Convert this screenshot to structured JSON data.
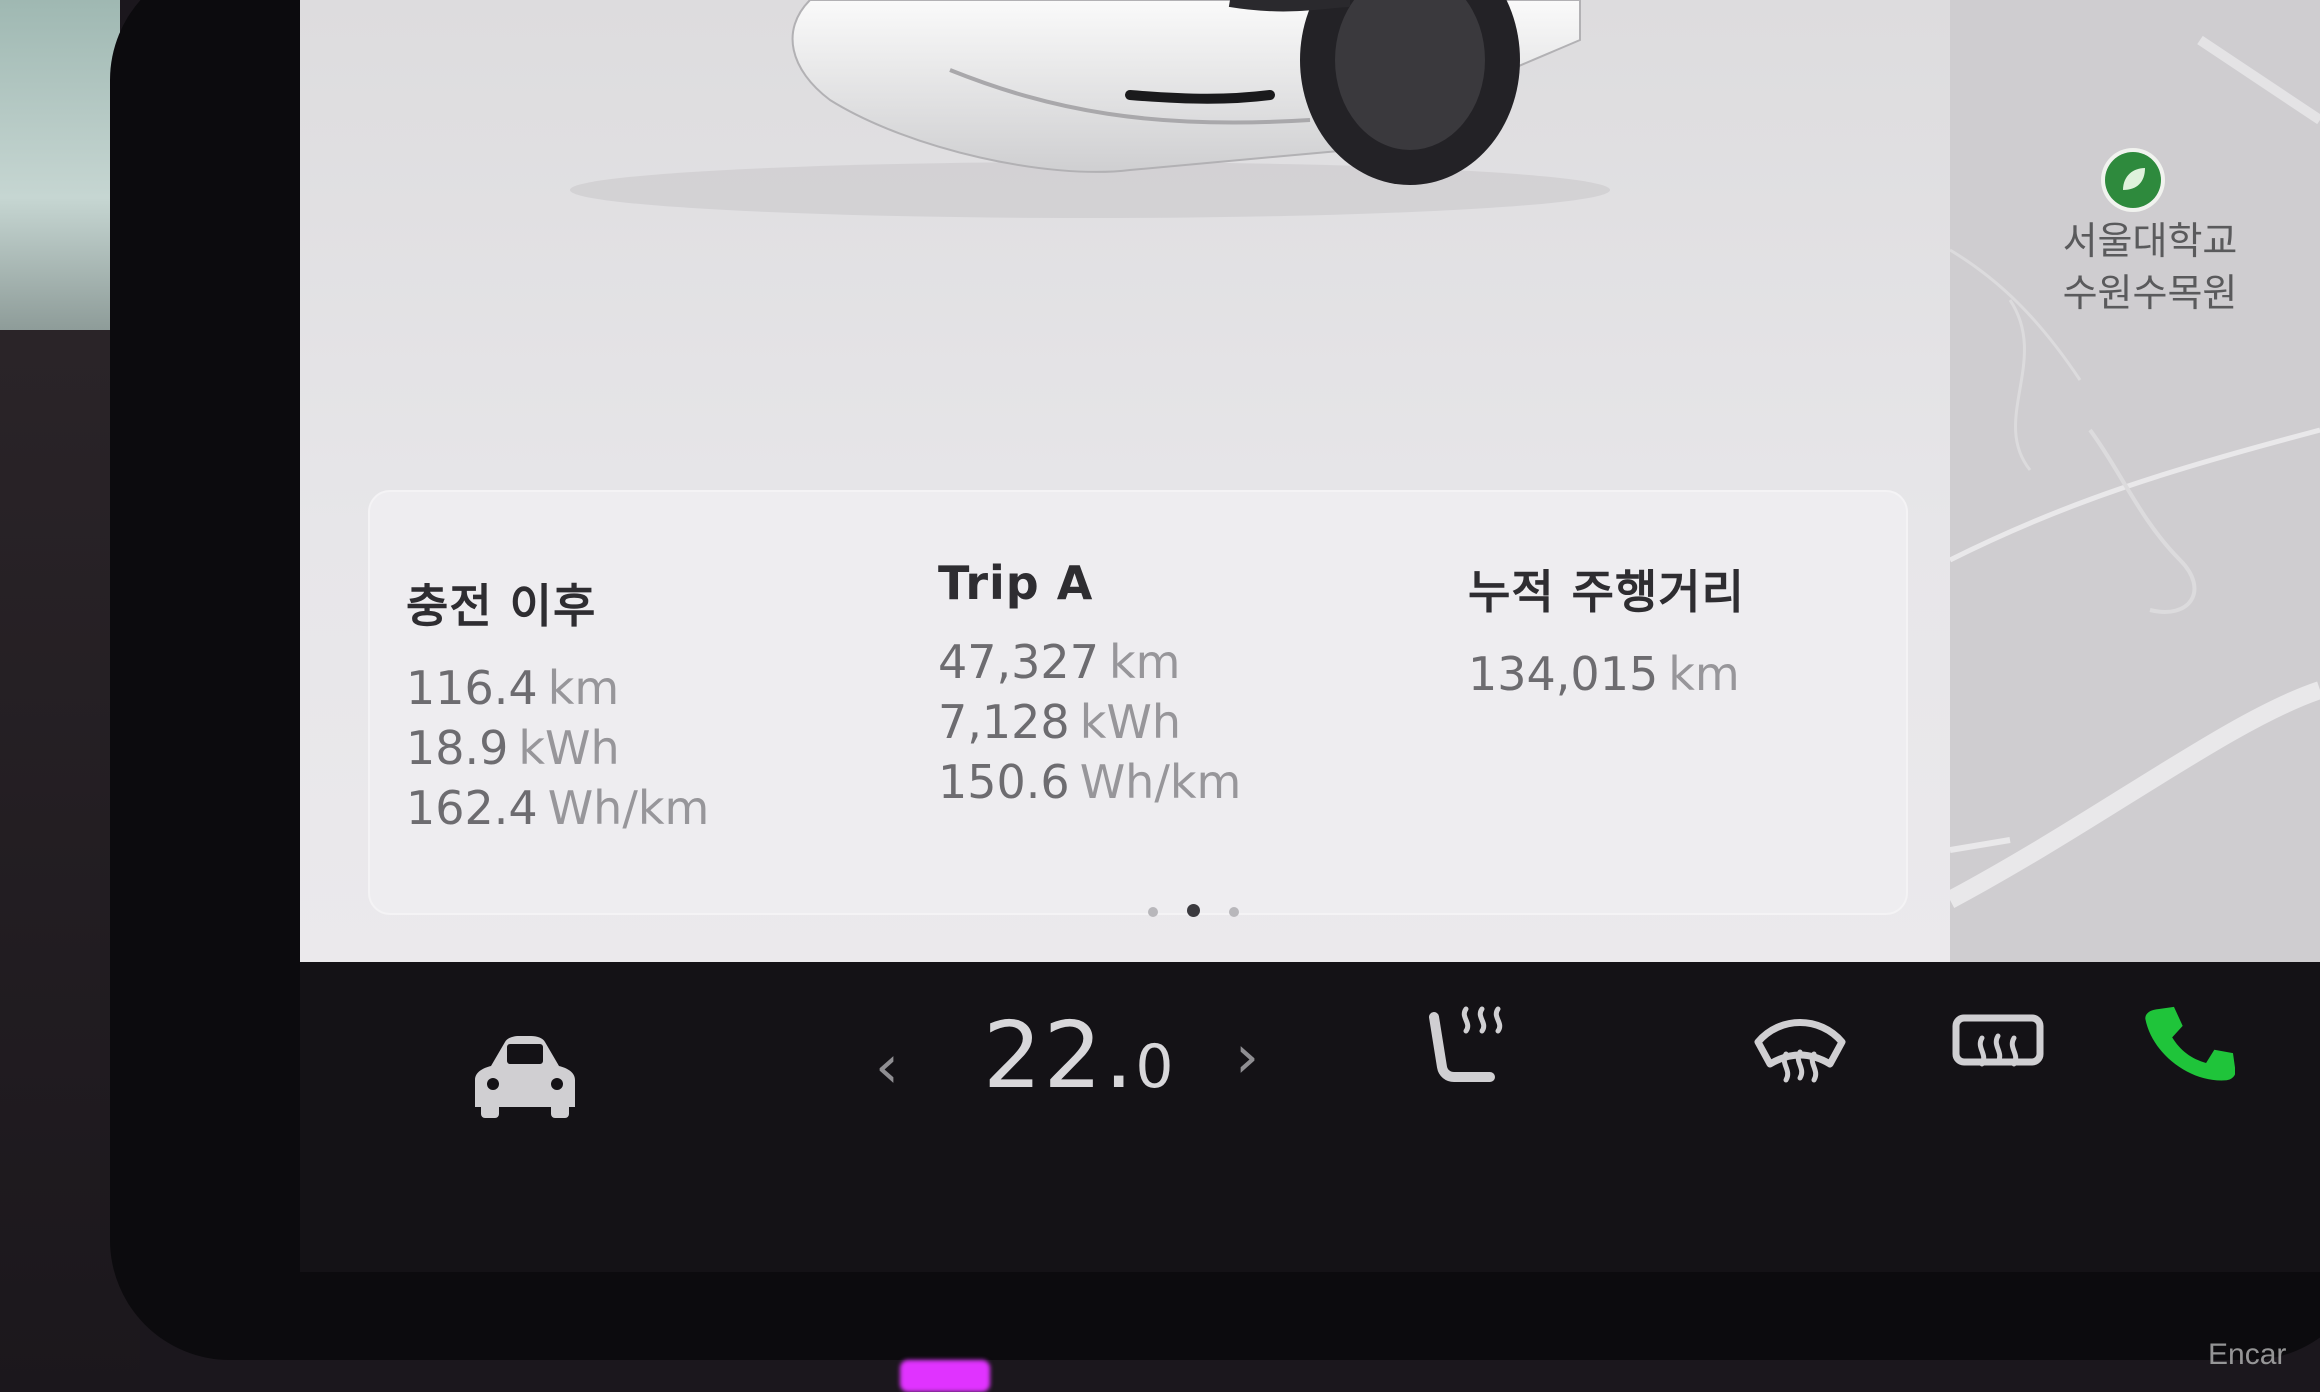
{
  "trip_stats": {
    "since_charge": {
      "title": "충전 이후",
      "distance": {
        "value": "116.4",
        "unit": "km"
      },
      "energy": {
        "value": "18.9",
        "unit": "kWh"
      },
      "efficiency": {
        "value": "162.4",
        "unit": "Wh/km"
      }
    },
    "trip_a": {
      "title": "Trip A",
      "distance": {
        "value": "47,327",
        "unit": "km"
      },
      "energy": {
        "value": "7,128",
        "unit": "kWh"
      },
      "efficiency": {
        "value": "150.6",
        "unit": "Wh/km"
      }
    },
    "odometer": {
      "title": "누적 주행거리",
      "distance": {
        "value": "134,015",
        "unit": "km"
      }
    }
  },
  "page_indicator": {
    "count": 3,
    "active": 2
  },
  "map": {
    "poi_line1": "서울대학교",
    "poi_line2": "수원수목원",
    "poi_icon": "park-icon"
  },
  "climate": {
    "temp_integer": "22.",
    "temp_decimal": "0",
    "decrease_icon": "chevron-left-icon",
    "increase_icon": "chevron-right-icon"
  },
  "bottom_bar_icons": [
    "car-icon",
    "seat-heater-icon",
    "front-defrost-icon",
    "rear-defrost-icon",
    "phone-icon"
  ],
  "colors": {
    "phone_green": "#1fc43a",
    "screen_bg": "#e2e1e3",
    "bar_bg": "#141216"
  },
  "watermark": "Encar"
}
